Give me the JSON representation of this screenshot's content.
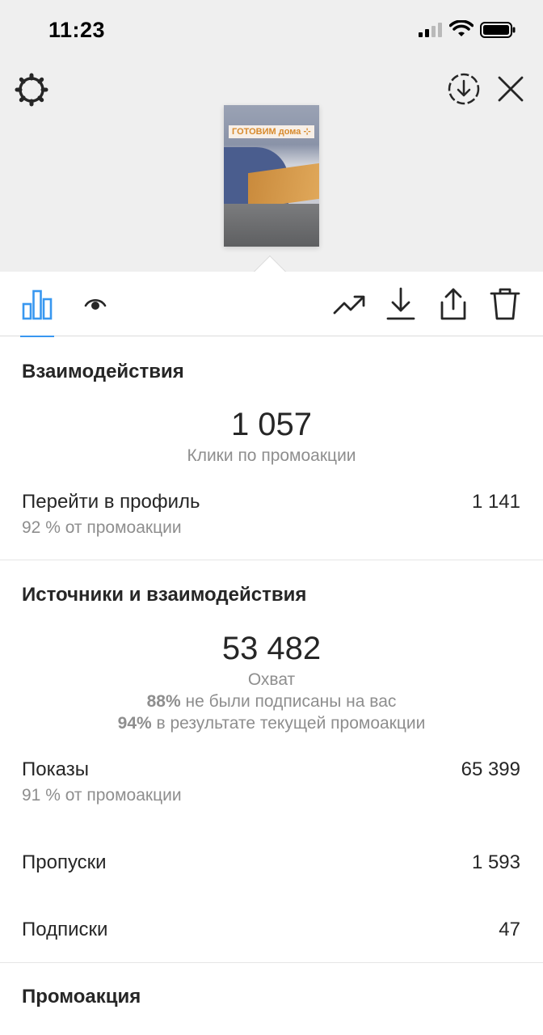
{
  "status_bar": {
    "time": "11:23"
  },
  "story_preview": {
    "caption": "ГОТОВИМ дома ⊹"
  },
  "interactions": {
    "title": "Взаимодействия",
    "clicks_value": "1 057",
    "clicks_label": "Клики по промоакции",
    "profile_label": "Перейти в профиль",
    "profile_value": "1 141",
    "profile_sub": "92 % от промоакции"
  },
  "discovery": {
    "title": "Источники и взаимодействия",
    "reach_value": "53 482",
    "reach_label": "Охват",
    "not_following_pct": "88%",
    "not_following_text": " не были подписаны на вас",
    "from_promo_pct": "94%",
    "from_promo_text": " в результате текущей промоакции",
    "impressions_label": "Показы",
    "impressions_value": "65 399",
    "impressions_sub": "91 % от промоакции",
    "skips_label": "Пропуски",
    "skips_value": "1 593",
    "follows_label": "Подписки",
    "follows_value": "47"
  },
  "promotion": {
    "title": "Промоакция"
  },
  "colors": {
    "accent": "#3897f0",
    "text": "#262626",
    "secondary": "#8e8e8e",
    "header_bg": "#efefef"
  }
}
